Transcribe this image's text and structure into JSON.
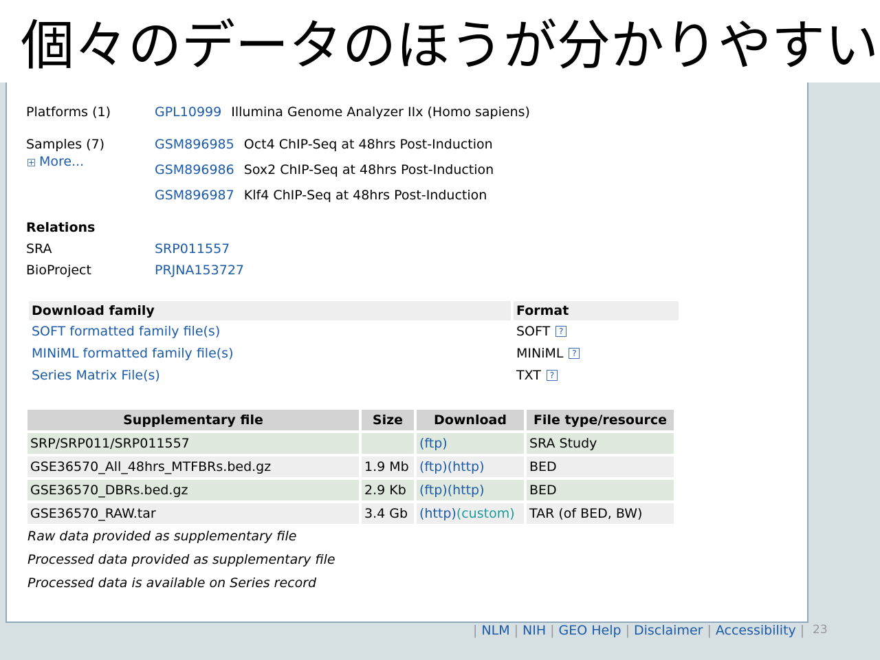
{
  "slide": {
    "title": "個々のデータのほうが分かりやすい",
    "page_number": "23"
  },
  "platforms": {
    "label": "Platforms (1)",
    "id": "GPL10999",
    "description": "Illumina Genome Analyzer IIx (Homo sapiens)"
  },
  "samples": {
    "label": "Samples (7)",
    "more_label": "More...",
    "items": [
      {
        "id": "GSM896985",
        "description": "Oct4 ChIP-Seq at 48hrs Post-Induction"
      },
      {
        "id": "GSM896986",
        "description": "Sox2 ChIP-Seq at 48hrs Post-Induction"
      },
      {
        "id": "GSM896987",
        "description": "Klf4 ChIP-Seq at 48hrs Post-Induction"
      }
    ]
  },
  "relations": {
    "heading": "Relations",
    "items": [
      {
        "label": "SRA",
        "value": "SRP011557"
      },
      {
        "label": "BioProject",
        "value": "PRJNA153727"
      }
    ]
  },
  "download_family": {
    "headers": [
      "Download family",
      "Format"
    ],
    "rows": [
      {
        "name": "SOFT formatted family file(s)",
        "format": "SOFT"
      },
      {
        "name": "MINiML formatted family file(s)",
        "format": "MINiML"
      },
      {
        "name": "Series Matrix File(s)",
        "format": "TXT"
      }
    ],
    "help_glyph": "?"
  },
  "supplementary": {
    "headers": [
      "Supplementary file",
      "Size",
      "Download",
      "File type/resource"
    ],
    "rows": [
      {
        "file": "SRP/SRP011/SRP011557",
        "size": "",
        "download": [
          "(ftp)"
        ],
        "type": "SRA Study"
      },
      {
        "file": "GSE36570_All_48hrs_MTFBRs.bed.gz",
        "size": "1.9 Mb",
        "download": [
          "(ftp)",
          "(http)"
        ],
        "type": "BED"
      },
      {
        "file": "GSE36570_DBRs.bed.gz",
        "size": "2.9 Kb",
        "download": [
          "(ftp)",
          "(http)"
        ],
        "type": "BED"
      },
      {
        "file": "GSE36570_RAW.tar",
        "size": "3.4 Gb",
        "download": [
          "(http)",
          "(custom)"
        ],
        "type": "TAR (of BED, BW)"
      }
    ],
    "notes": [
      "Raw data provided as supplementary file",
      "Processed data provided as supplementary file",
      "Processed data is available on Series record"
    ]
  },
  "footer": {
    "links": [
      "NLM",
      "NIH",
      "GEO Help",
      "Disclaimer",
      "Accessibility"
    ],
    "separator": "|"
  },
  "colors": {
    "link": "#1b5ba7",
    "header_bg": "#d3d3d3",
    "row_green": "#dfe9dd",
    "row_grey": "#eeeeee",
    "custom_link": "#1f9a9a",
    "panel_border": "#8ea9bd",
    "side_bg": "#d6dfe2"
  },
  "icons": {
    "expand": "plus-box-icon",
    "help": "question-box-icon"
  }
}
